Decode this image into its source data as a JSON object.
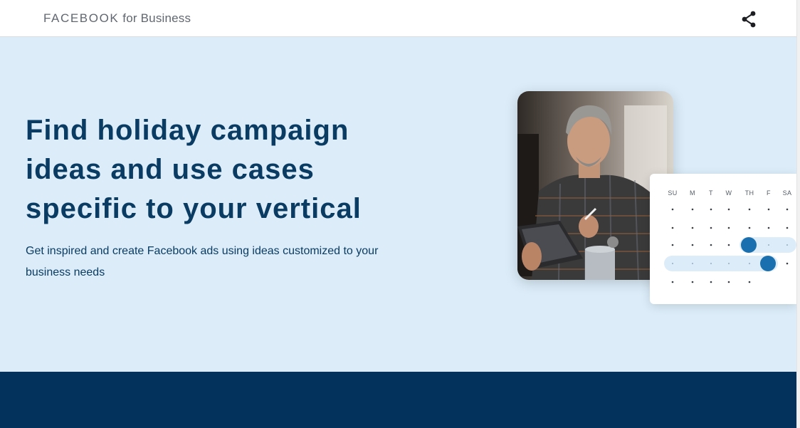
{
  "header": {
    "brand_main": "FACEBOOK",
    "brand_suffix": "for Business",
    "share_icon": "share-icon"
  },
  "hero": {
    "headline": "Find holiday campaign ideas and use cases specific to your vertical",
    "subtext": "Get inspired and create Facebook ads using ideas customized to your business needs",
    "image": "man-with-tablet-photo"
  },
  "calendar": {
    "days": [
      "SU",
      "M",
      "T",
      "W",
      "TH",
      "F",
      "SA"
    ],
    "highlight_color": "#1a6fae",
    "range_color": "#dcedf9"
  },
  "colors": {
    "hero_bg": "#dcedf9",
    "headline": "#0a3c63",
    "band": "#03335c"
  }
}
